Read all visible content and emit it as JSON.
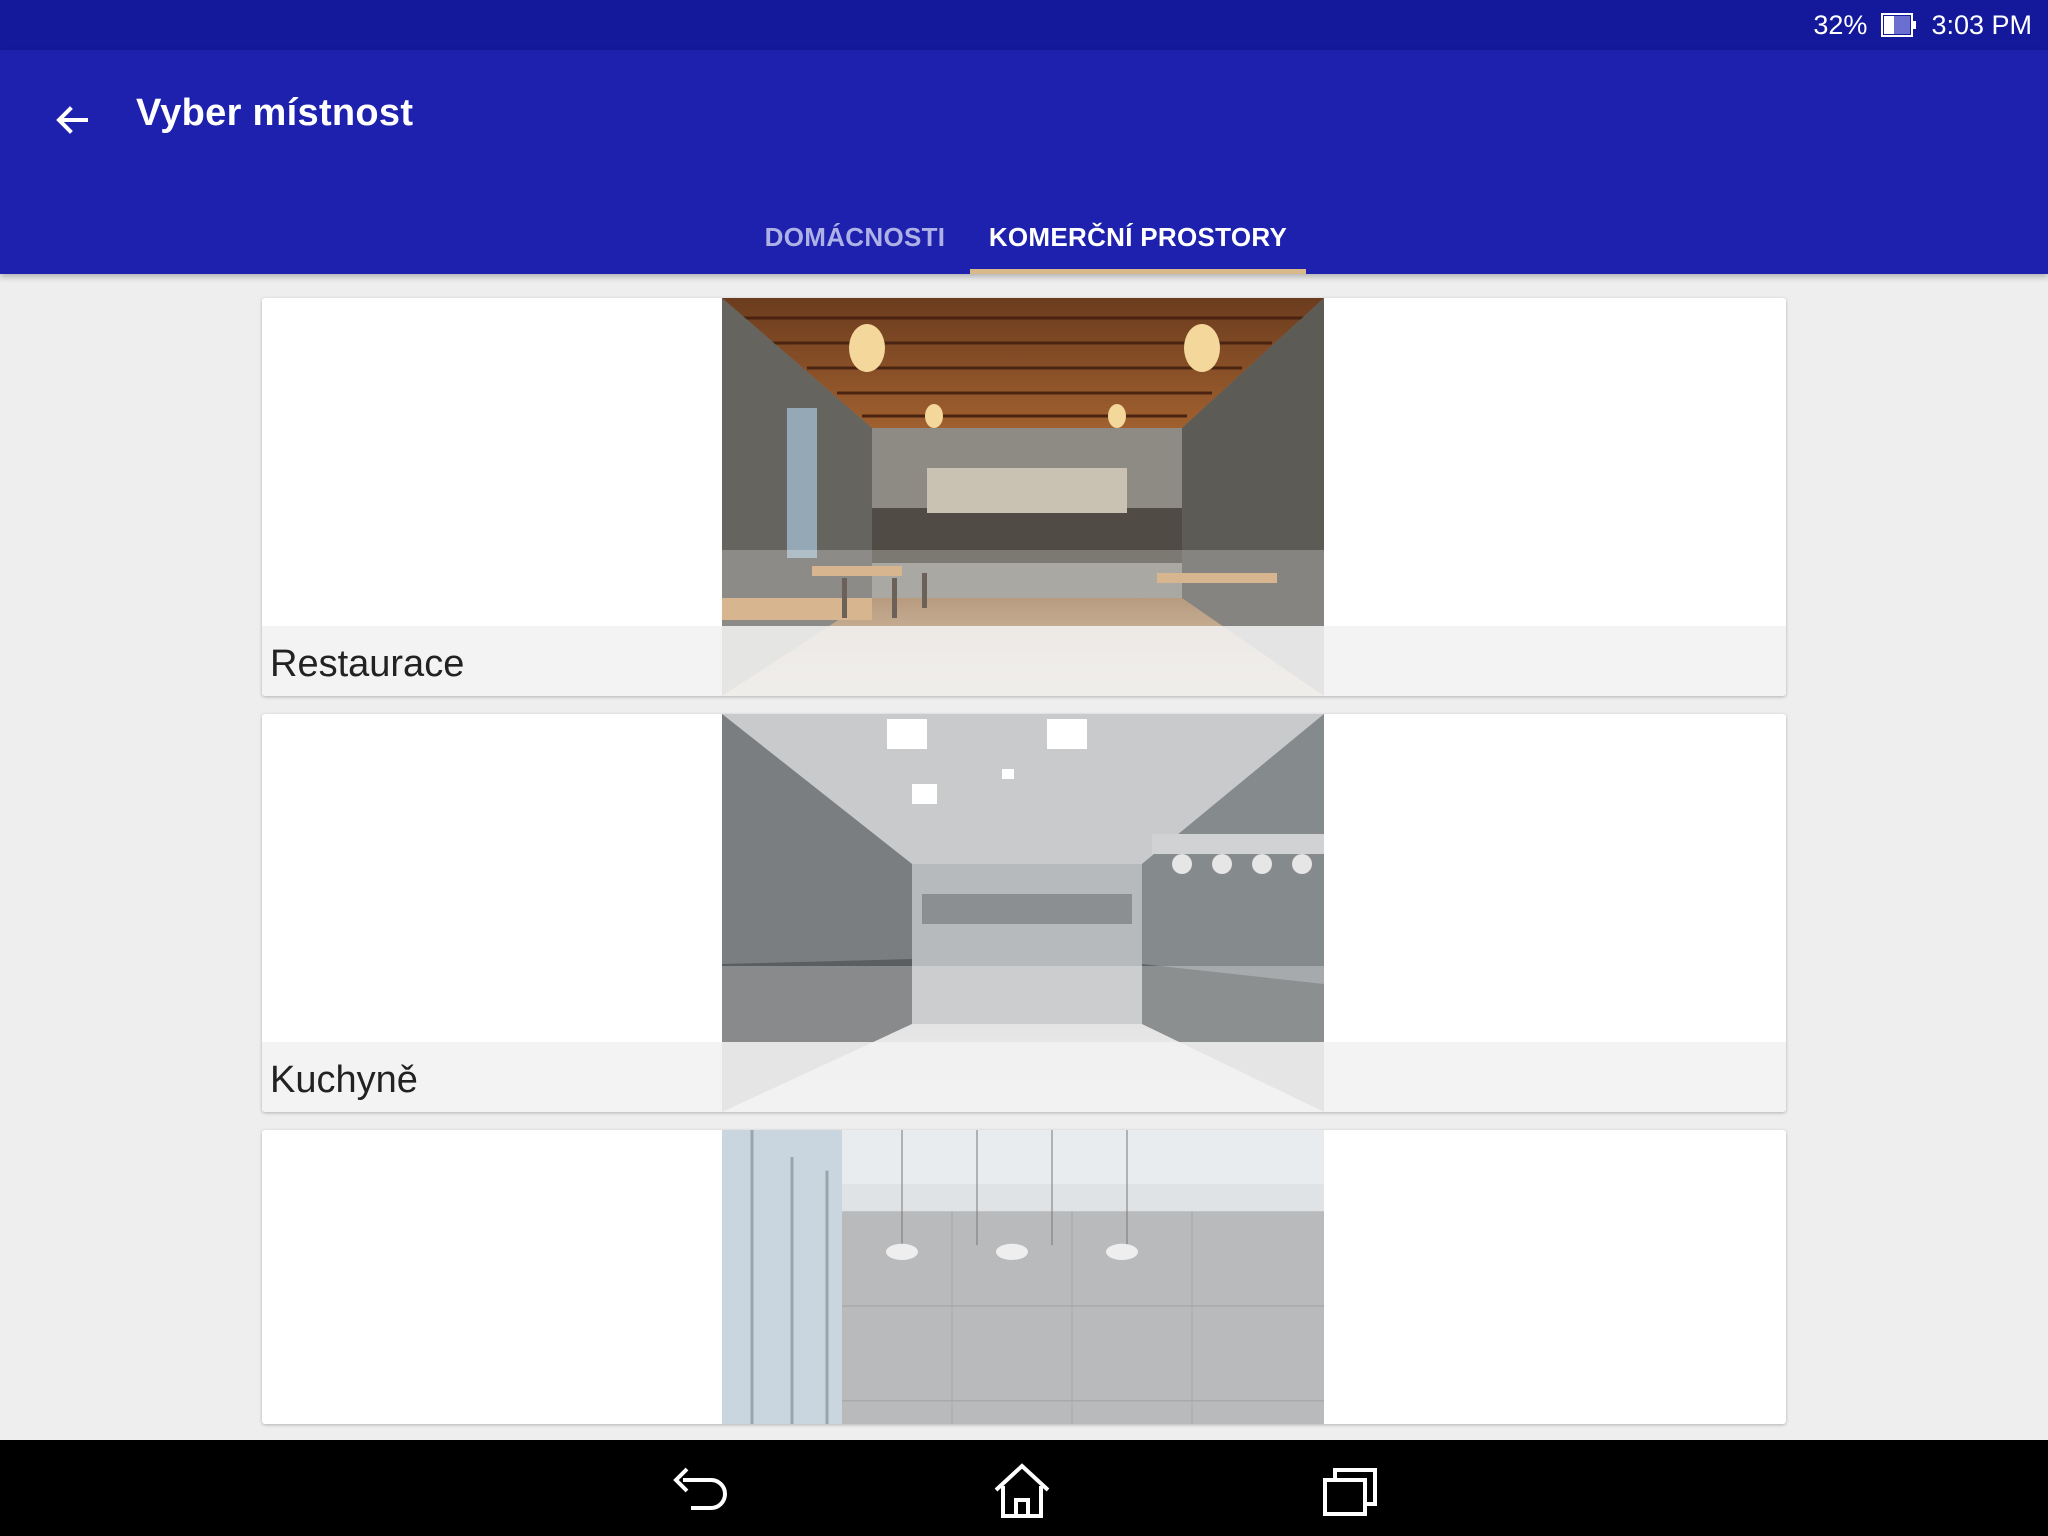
{
  "status_bar": {
    "battery_percent": "32%",
    "time": "3:03 PM"
  },
  "app_bar": {
    "title": "Vyber místnost",
    "tabs": [
      {
        "label": "DOMÁCNOSTI",
        "selected": false
      },
      {
        "label": "KOMERČNÍ PROSTORY",
        "selected": true
      }
    ]
  },
  "rooms": [
    {
      "label": "Restaurace",
      "image": "restaurant-interior"
    },
    {
      "label": "Kuchyně",
      "image": "commercial-kitchen"
    },
    {
      "label": "",
      "image": "meeting-room"
    }
  ],
  "nav_bar": {
    "icons": [
      "back-icon",
      "home-icon",
      "recents-icon"
    ]
  },
  "colors": {
    "status_bar": "#14199b",
    "app_bar": "#1d21ad",
    "tab_indicator": "#d9b88a",
    "background": "#eeeeee"
  }
}
